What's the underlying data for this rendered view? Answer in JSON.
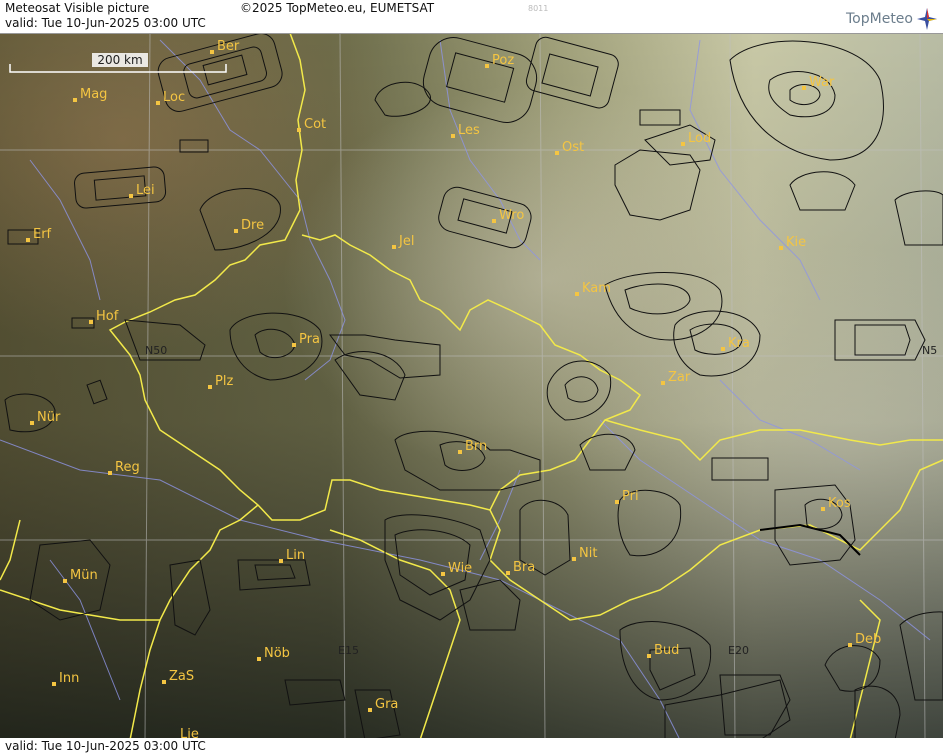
{
  "header": {
    "title": "Meteosat Visible picture",
    "valid_line": "valid:  Tue  10-Jun-2025  03:00 UTC",
    "copyright": "©2025 TopMeteo.eu, EUMETSAT",
    "code": "8011",
    "logo_text": "TopMeteo",
    "logo_icon": "compass-star-icon"
  },
  "footer": {
    "valid_line": "valid:  Tue  10-Jun-2025  03:00 UTC"
  },
  "scale": {
    "label": "200 km"
  },
  "grid": {
    "lat_label": "N50",
    "lat_label_right": "N5",
    "lon_labels": [
      "E15",
      "E20"
    ]
  },
  "cities": [
    {
      "name": "Ber"
    },
    {
      "name": "Poz"
    },
    {
      "name": "War"
    },
    {
      "name": "Mag"
    },
    {
      "name": "Loc"
    },
    {
      "name": "Cot"
    },
    {
      "name": "Les"
    },
    {
      "name": "Ost"
    },
    {
      "name": "Lod"
    },
    {
      "name": "Lei"
    },
    {
      "name": "Dre"
    },
    {
      "name": "Wro"
    },
    {
      "name": "Erf"
    },
    {
      "name": "Jel"
    },
    {
      "name": "Kie"
    },
    {
      "name": "Kam"
    },
    {
      "name": "Hof"
    },
    {
      "name": "Pra"
    },
    {
      "name": "Kra"
    },
    {
      "name": "Zar"
    },
    {
      "name": "Plz"
    },
    {
      "name": "Nür"
    },
    {
      "name": "Brn"
    },
    {
      "name": "Reg"
    },
    {
      "name": "Pri"
    },
    {
      "name": "Kos"
    },
    {
      "name": "Nit"
    },
    {
      "name": "Lin"
    },
    {
      "name": "Wie"
    },
    {
      "name": "Bra"
    },
    {
      "name": "Mün"
    },
    {
      "name": "Bud"
    },
    {
      "name": "Deb"
    },
    {
      "name": "Nöb"
    },
    {
      "name": "Inn"
    },
    {
      "name": "ZaS"
    },
    {
      "name": "Gra"
    },
    {
      "name": "Lie"
    }
  ],
  "colors": {
    "border": "#f2e94a",
    "river": "#8e95e6",
    "contour": "#111111",
    "city": "#f4c542"
  }
}
